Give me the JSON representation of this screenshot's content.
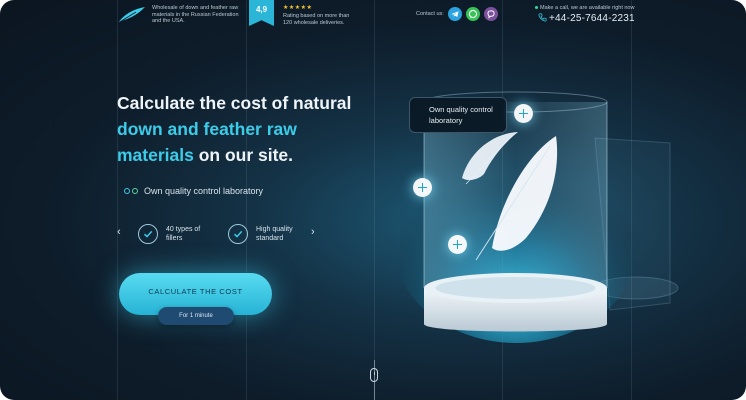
{
  "header": {
    "tagline": "Wholesale of down and feather raw materials in the Russian Federation and the USA.",
    "rating_value": "4,9",
    "stars": "★★★★★",
    "rating_text": "Rating based on more than 120 wholesale deliveries.",
    "contact_label": "Contact us:",
    "messengers": [
      {
        "name": "telegram-icon",
        "color": "#2aa3df"
      },
      {
        "name": "whatsapp-icon",
        "color": "#37c456"
      },
      {
        "name": "viber-icon",
        "color": "#7b519d"
      }
    ],
    "call_note": "Make a call, we are available right now",
    "phone": "+44-25-7644-2231"
  },
  "hero": {
    "headline_1": "Calculate",
    "headline_2": " the cost of natural ",
    "headline_3": "down and feather raw materials",
    "headline_4": " on our site.",
    "lab_label": "Own quality control laboratory",
    "features": [
      {
        "label": "40 types of fillers"
      },
      {
        "label": "High quality standard"
      }
    ],
    "prev_arrow": "‹",
    "next_arrow": "›",
    "cta_label": "CALCULATE THE COST",
    "cta_badge": "For 1 minute"
  },
  "scene": {
    "lab_card": "Own quality control laboratory"
  },
  "colors": {
    "accent": "#3ccce9",
    "background": "#0e1d2b"
  }
}
